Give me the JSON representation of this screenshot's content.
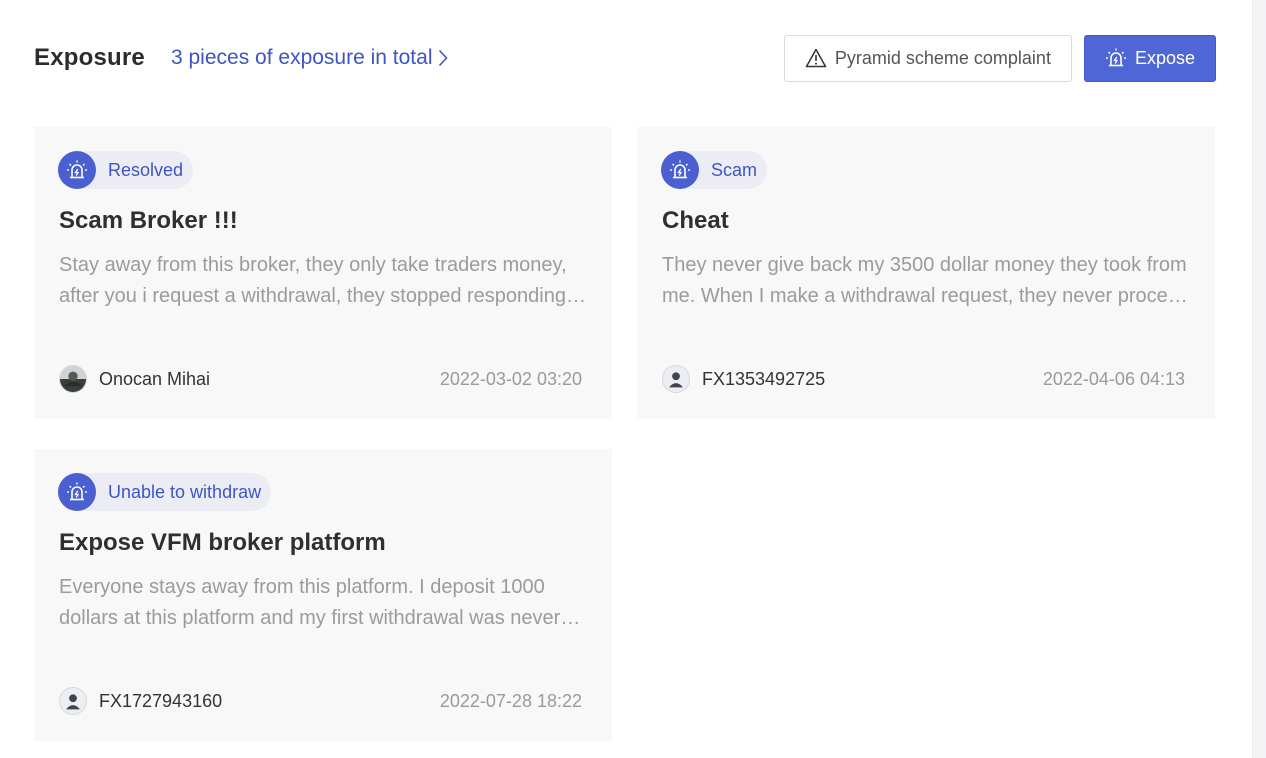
{
  "header": {
    "title": "Exposure",
    "total_link": "3 pieces of exposure in total",
    "complaint_button": "Pyramid scheme complaint",
    "expose_button": "Expose"
  },
  "cards": [
    {
      "tag": "Resolved",
      "title": "Scam Broker !!!",
      "description": "Stay away from this broker, they only take traders money, after you i request a withdrawal, they stopped responding and my account was blocked.",
      "author": "Onocan Mihai",
      "date": "2022-03-02 03:20",
      "avatar_icon": "user-photo-icon"
    },
    {
      "tag": "Scam",
      "title": "Cheat",
      "description": "They never give back my 3500 dollar money they took from me. When I make a withdrawal request, they never process it and stop replying.",
      "author": "FX1353492725",
      "date": "2022-04-06 04:13",
      "avatar_icon": "default-user-icon"
    },
    {
      "tag": "Unable to withdraw",
      "title": "Expose VFM broker platform",
      "description": "Everyone stays away from this platform. I deposit 1000 dollars at this platform and my first withdrawal was never processed by them.",
      "author": "FX1727943160",
      "date": "2022-07-28 18:22",
      "avatar_icon": "default-user-icon"
    }
  ],
  "colors": {
    "accent": "#4e66d6",
    "link": "#3d55c4",
    "tag_bg": "#ecedf4",
    "card_bg": "#f8f8f9"
  }
}
